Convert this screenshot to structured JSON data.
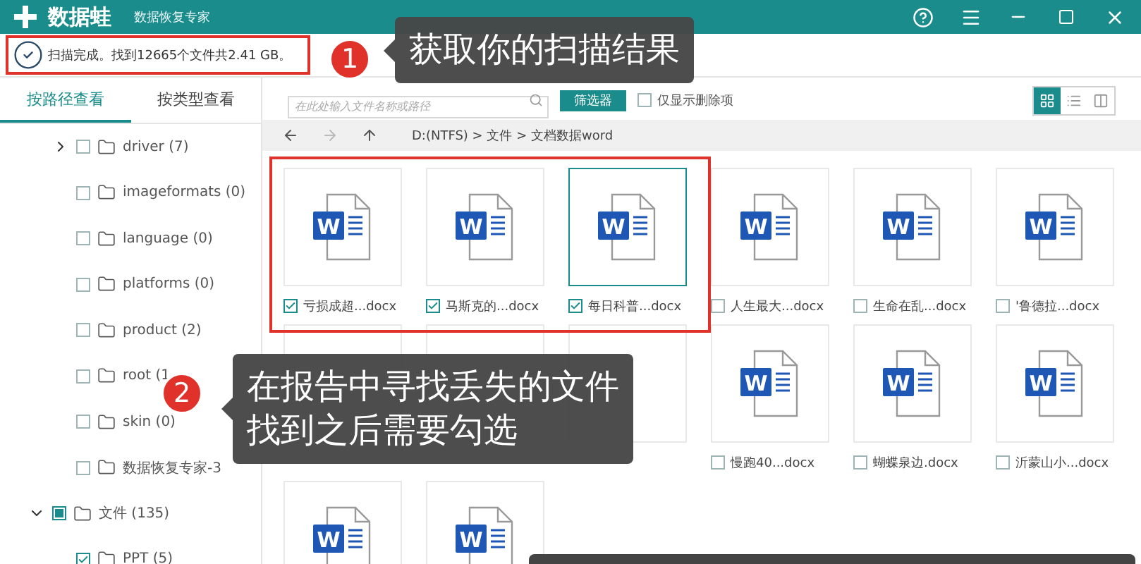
{
  "title_bar": {
    "logo_text": "数据蛙",
    "subtitle": "数据恢复专家"
  },
  "status": {
    "text": "扫描完成。找到12665个文件共2.41 GB。"
  },
  "view_tabs": [
    {
      "label": "按路径查看",
      "selected": true
    },
    {
      "label": "按类型查看",
      "selected": false
    }
  ],
  "tree": [
    {
      "kind": "group",
      "children": [
        {
          "label": "driver (7)",
          "expanded": false,
          "checked": false,
          "partial": false
        },
        {
          "label": "imageformats (0)",
          "checked": false,
          "partial": false
        },
        {
          "label": "language (0)",
          "checked": false,
          "partial": false
        },
        {
          "label": "platforms (0)",
          "checked": false,
          "partial": false
        },
        {
          "label": "product (2)",
          "checked": false,
          "partial": false
        },
        {
          "label": "root (1",
          "checked": false,
          "partial": false
        },
        {
          "label": "skin (0)",
          "checked": false,
          "partial": false
        },
        {
          "label": "数据恢复专家-3",
          "checked": false,
          "partial": false
        }
      ]
    },
    {
      "kind": "item",
      "label": "文件 (135)",
      "expanded": true,
      "checked": false,
      "partial": true,
      "children": [
        {
          "label": "PPT (5)",
          "checked": true
        }
      ]
    }
  ],
  "toolbar": {
    "search_placeholder": "在此处输入文件名称或路径",
    "filter_button": "筛选器",
    "deleted_only": {
      "label": "仅显示删除项",
      "checked": false
    },
    "view_modes": [
      {
        "selected": true
      },
      {
        "selected": false
      },
      {
        "selected": false
      }
    ]
  },
  "nav": {
    "back_disabled": false,
    "forward_disabled": true,
    "path": "D:(NTFS) > 文件 > 文档数据word"
  },
  "files": [
    {
      "name": "亏损成超...docx",
      "badge": "W",
      "checked": true,
      "selected": false
    },
    {
      "name": "马斯克的...docx",
      "badge": "W",
      "checked": true,
      "selected": false
    },
    {
      "name": "每日科普...docx",
      "badge": "W",
      "checked": true,
      "selected": true
    },
    {
      "name": "人生最大...docx",
      "badge": "W",
      "checked": false,
      "selected": false
    },
    {
      "name": "生命在乱...docx",
      "badge": "W",
      "checked": false,
      "selected": false
    },
    {
      "name": "'鲁德拉...docx",
      "badge": "W",
      "checked": false,
      "selected": false
    },
    {
      "selected": false
    },
    {
      "selected": false
    },
    {
      "selected": false
    },
    {
      "name": "慢跑40...docx",
      "badge": "W",
      "checked": false,
      "selected": false
    },
    {
      "name": "蝴蝶泉边.docx",
      "badge": "W",
      "checked": false,
      "selected": false
    },
    {
      "name": "沂蒙山小...docx",
      "badge": "W",
      "checked": false,
      "selected": false
    },
    {
      "badge": "W"
    },
    {
      "badge": "W"
    }
  ],
  "annotations": [
    {
      "number": "1",
      "lines": [
        "获取你的扫描结果"
      ]
    },
    {
      "number": "2",
      "lines": [
        "在报告中寻找丢失的文件",
        "找到之后需要勾选"
      ]
    }
  ]
}
